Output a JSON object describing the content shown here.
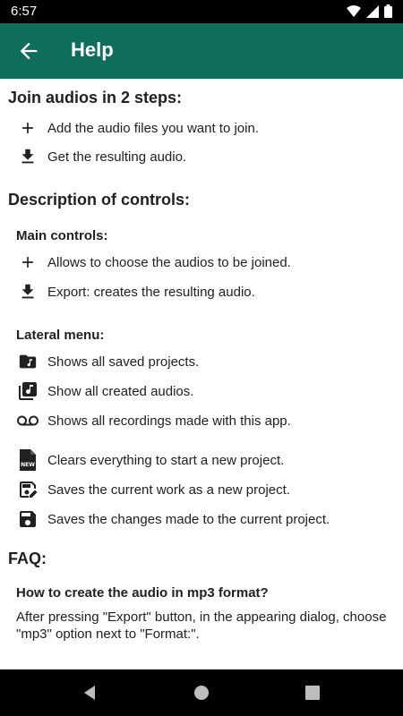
{
  "status": {
    "time": "6:57"
  },
  "app_bar": {
    "title": "Help"
  },
  "join": {
    "heading": "Join audios in 2 steps:",
    "steps": [
      "Add the audio files you want to join.",
      "Get the resulting audio."
    ]
  },
  "controls": {
    "heading": "Description of controls:",
    "main_heading": "Main controls:",
    "main": [
      "Allows to choose the audios to be joined.",
      "Export: creates the resulting audio."
    ],
    "lateral_heading": "Lateral menu:",
    "lateral": [
      "Shows all saved projects.",
      "Show all created audios.",
      "Shows all recordings made with this app."
    ],
    "project": [
      "Clears everything to start a new project.",
      "Saves the current work as a new project.",
      "Saves the changes made to the current project."
    ],
    "new_icon_text": "NEW"
  },
  "faq": {
    "heading": "FAQ:",
    "question": "How to create the audio in mp3 format?",
    "answer": "After pressing \"Export\" button, in the appearing dialog, choose \"mp3\" option next to \"Format:\"."
  },
  "icons": {
    "plus": "plus-icon",
    "download": "download-icon",
    "folder": "folder-music-icon",
    "library": "music-library-icon",
    "voicemail": "voicemail-icon",
    "new_file": "new-file-icon",
    "save_edit": "save-as-icon",
    "save": "save-icon"
  },
  "colors": {
    "app_bar": "#0f6d5d",
    "status_bar": "#000000",
    "nav_bar": "#000000",
    "icon": "#212121"
  }
}
